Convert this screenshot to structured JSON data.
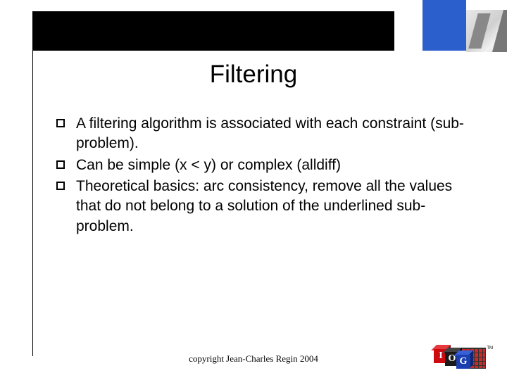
{
  "title": "Filtering",
  "bullets": [
    "A filtering algorithm is associated with each constraint (sub-problem).",
    "Can be simple (x < y) or complex (alldiff)",
    "Theoretical basics: arc consistency, remove all the values that do not belong to a solution of the underlined sub-problem."
  ],
  "footer": "copyright Jean-Charles Regin 2004",
  "logo": {
    "l1": "I",
    "l2": "O",
    "l3": "G",
    "tm": "TM"
  }
}
